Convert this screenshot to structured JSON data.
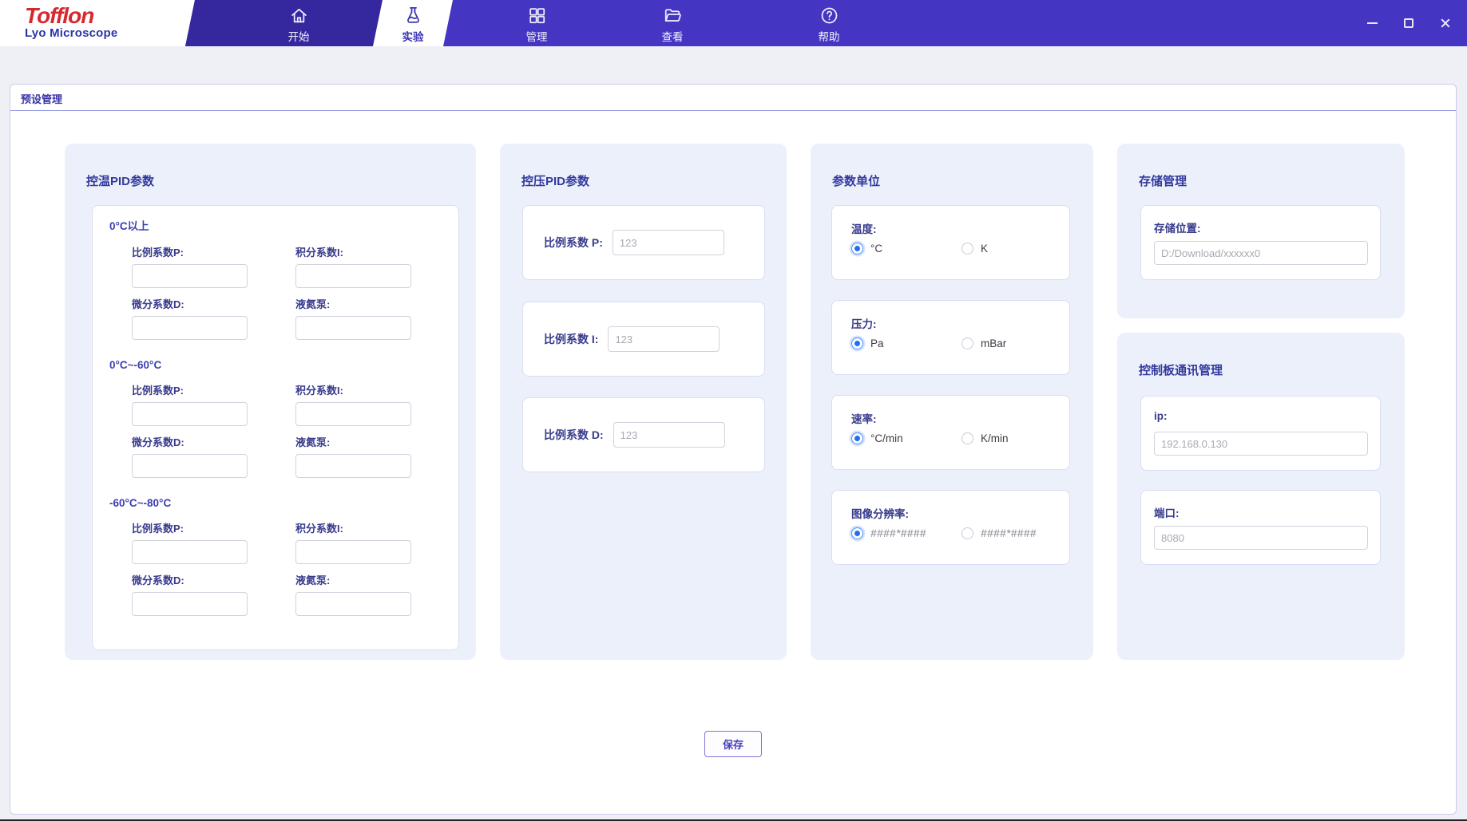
{
  "window": {
    "brand": "Tofflon",
    "brand_sub": "Lyo Microscope",
    "controls": [
      "minimize",
      "maximize",
      "close"
    ]
  },
  "nav": {
    "tabs": [
      {
        "label": "开始",
        "icon": "home-icon",
        "state": "dark"
      },
      {
        "label": "实验",
        "icon": "flask-icon",
        "state": "active"
      },
      {
        "label": "管理",
        "icon": "grid-icon",
        "state": "normal"
      },
      {
        "label": "查看",
        "icon": "folder-icon",
        "state": "normal"
      },
      {
        "label": "帮助",
        "icon": "help-icon",
        "state": "normal"
      }
    ]
  },
  "page": {
    "tab_label": "预设管理",
    "save_label": "保存"
  },
  "panels": {
    "temp_pid": {
      "title": "控温PID参数",
      "sections": [
        {
          "title": "0°C以上",
          "fields": [
            {
              "label": "比例系数P:",
              "value": ""
            },
            {
              "label": "积分系数I:",
              "value": ""
            },
            {
              "label": "微分系数D:",
              "value": ""
            },
            {
              "label": "液氮泵:",
              "value": ""
            }
          ]
        },
        {
          "title": "0°C~-60°C",
          "fields": [
            {
              "label": "比例系数P:",
              "value": ""
            },
            {
              "label": "积分系数I:",
              "value": ""
            },
            {
              "label": "微分系数D:",
              "value": ""
            },
            {
              "label": "液氮泵:",
              "value": ""
            }
          ]
        },
        {
          "title": "-60°C~-80°C",
          "fields": [
            {
              "label": "比例系数P:",
              "value": ""
            },
            {
              "label": "积分系数I:",
              "value": ""
            },
            {
              "label": "微分系数D:",
              "value": ""
            },
            {
              "label": "液氮泵:",
              "value": ""
            }
          ]
        }
      ]
    },
    "press_pid": {
      "title": "控压PID参数",
      "cards": [
        {
          "label": "比例系数 P:",
          "placeholder": "123"
        },
        {
          "label": "比例系数 I:",
          "placeholder": "123"
        },
        {
          "label": "比例系数 D:",
          "placeholder": "123"
        }
      ]
    },
    "units": {
      "title": "参数单位",
      "groups": [
        {
          "label": "温度:",
          "options": [
            {
              "text": "°C",
              "selected": true
            },
            {
              "text": "K",
              "selected": false
            }
          ]
        },
        {
          "label": "压力:",
          "options": [
            {
              "text": "Pa",
              "selected": true
            },
            {
              "text": "mBar",
              "selected": false
            }
          ]
        },
        {
          "label": "速率:",
          "options": [
            {
              "text": "°C/min",
              "selected": true
            },
            {
              "text": "K/min",
              "selected": false
            }
          ]
        },
        {
          "label": "图像分辨率:",
          "options": [
            {
              "text": "####*####",
              "selected": true
            },
            {
              "text": "####*####",
              "selected": false
            }
          ]
        }
      ]
    },
    "storage": {
      "title": "存储管理",
      "cards": [
        {
          "label": "存储位置:",
          "placeholder": "D:/Download/xxxxxx0"
        }
      ]
    },
    "comm": {
      "title": "控制板通讯管理",
      "cards": [
        {
          "label": "ip:",
          "placeholder": "192.168.0.130"
        },
        {
          "label": "端口:",
          "placeholder": "8080"
        }
      ]
    }
  },
  "colors": {
    "nav_bar": "#4435c2",
    "nav_tab_dark": "#35289f",
    "accent_indigo": "#3c35b5",
    "radio_blue": "#1f6ff5",
    "logo_red": "#d7282f",
    "panel_bg": "#ecf0fa"
  }
}
